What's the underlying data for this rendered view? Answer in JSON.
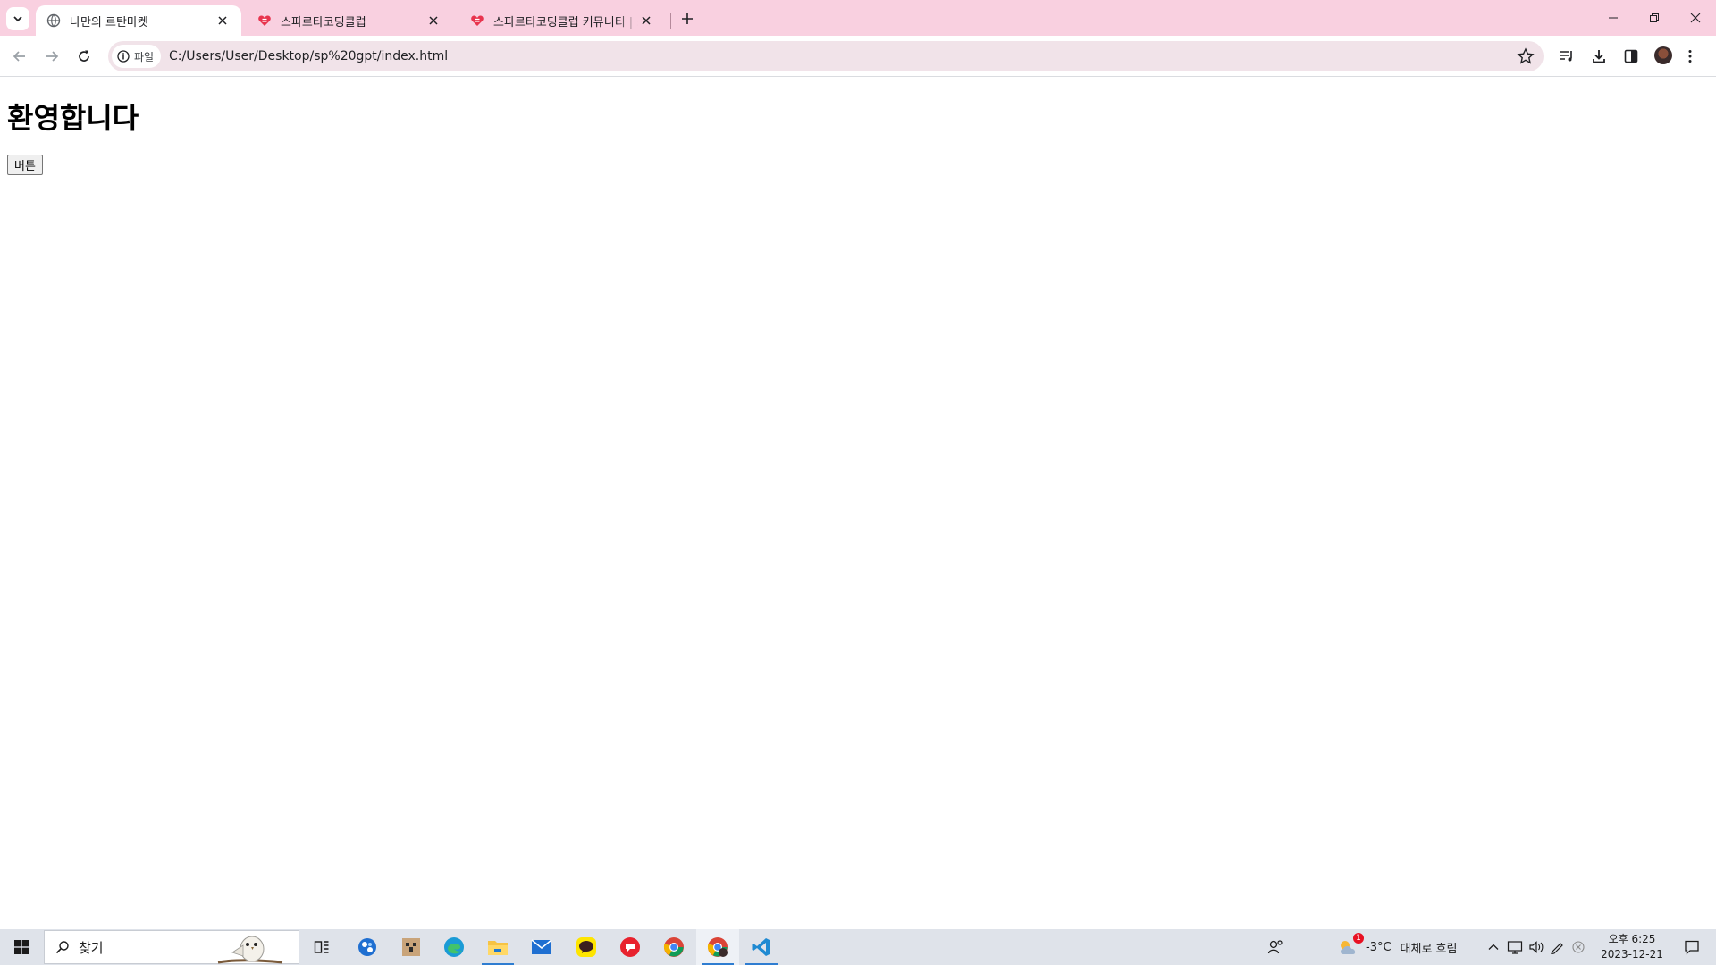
{
  "browser": {
    "tabs": [
      {
        "title": "나만의 르탄마켓",
        "favicon": "globe-icon",
        "active": true
      },
      {
        "title": "스파르타코딩클럽",
        "favicon": "sparta-heart-icon",
        "active": false
      },
      {
        "title": "스파르타코딩클럽 커뮤니티 | 스",
        "favicon": "sparta-heart-icon",
        "active": false
      }
    ],
    "address_chip": "파일",
    "url": "C:/Users/User/Desktop/sp%20gpt/index.html"
  },
  "page": {
    "heading": "환영합니다",
    "button_label": "버튼"
  },
  "taskbar": {
    "search_placeholder": "찾기",
    "apps": [
      "task-view-icon",
      "app-blue-icon",
      "app-minecraft-icon",
      "edge-icon",
      "file-explorer-icon",
      "mail-icon",
      "kakaotalk-icon",
      "app-red-icon",
      "chrome-icon",
      "chrome-profile-icon",
      "vscode-icon"
    ],
    "weather_temp": "-3°C",
    "weather_text": "대체로 흐림",
    "weather_badge": "1",
    "time": "오후 6:25",
    "date": "2023-12-21"
  },
  "colors": {
    "tabstrip": "#f9d0e0",
    "omnibox": "#f1e3e9",
    "taskbar": "#dfe3ea",
    "accent": "#2f7dd1"
  }
}
